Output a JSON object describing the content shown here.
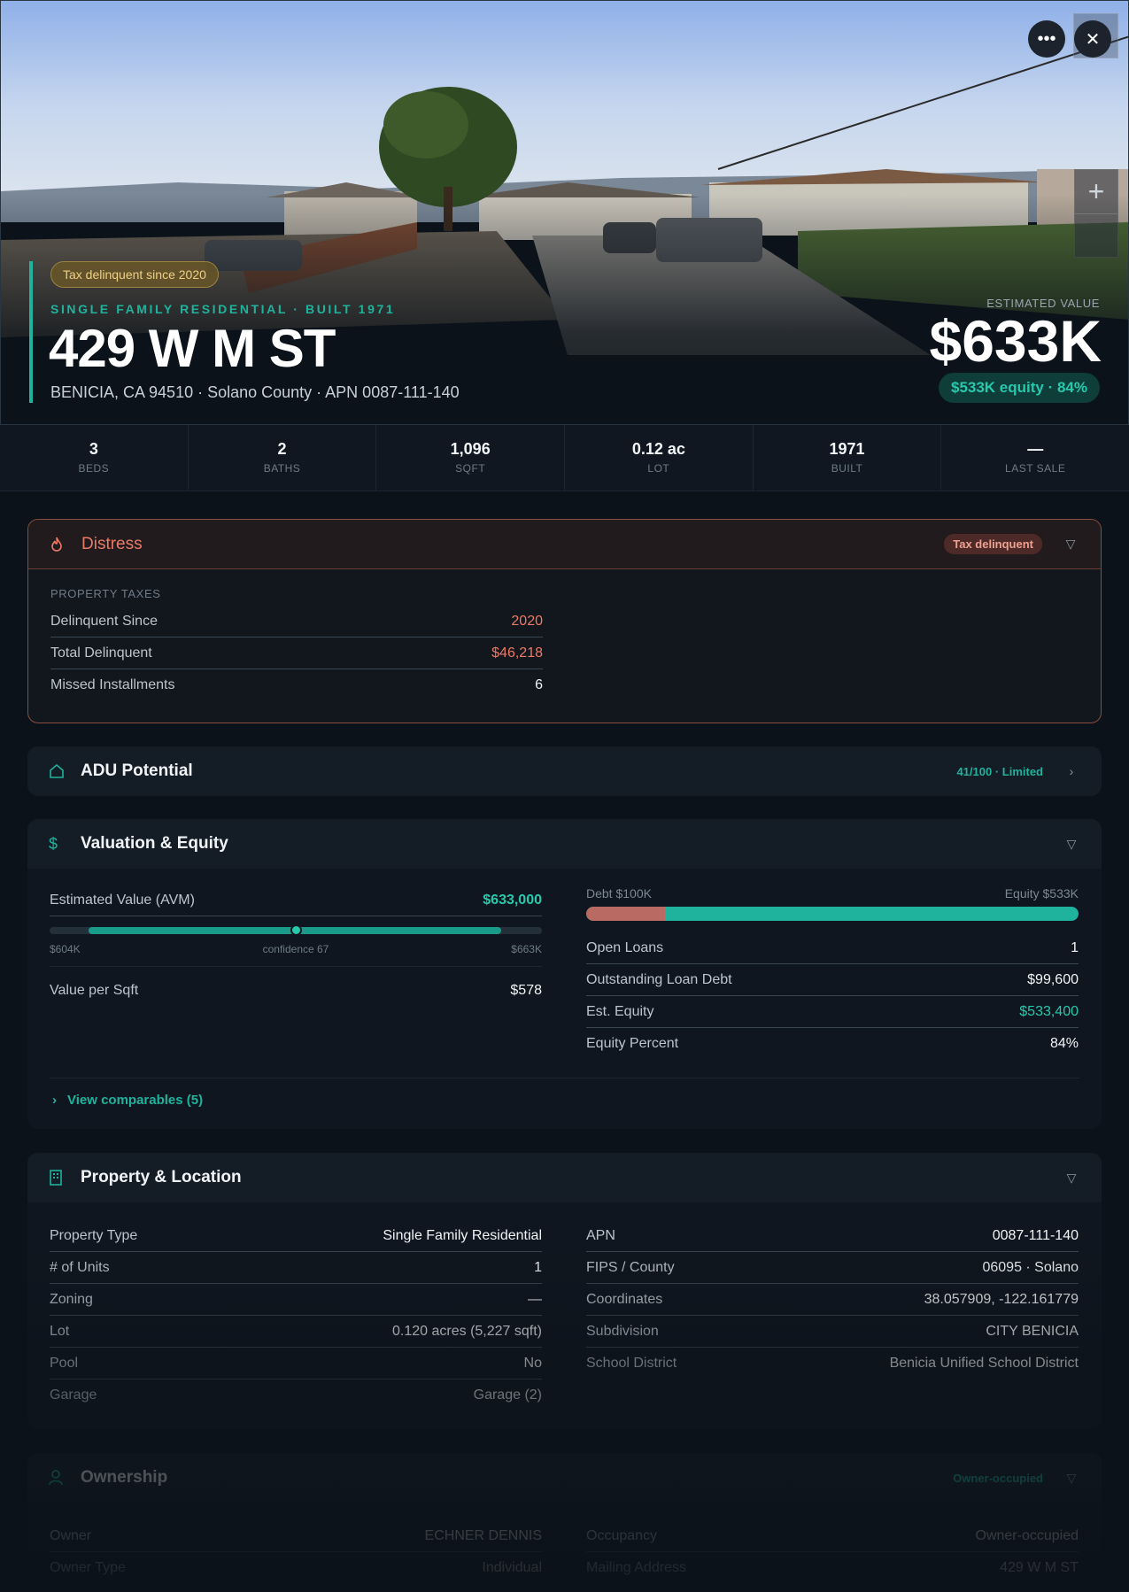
{
  "hero": {
    "tax_badge": "Tax delinquent since 2020",
    "subtitle": "SINGLE FAMILY RESIDENTIAL · BUILT 1971",
    "title": "429 W M ST",
    "address": "BENICIA, CA 94510 · Solano County · APN 0087-111-140",
    "est_label": "ESTIMATED VALUE",
    "est_value": "$633K",
    "equity_pill": "$533K equity · 84%",
    "more_icon": "more-icon",
    "close_icon": "close-icon",
    "zoom_plus": "+"
  },
  "stats": [
    {
      "value": "3",
      "label": "BEDS"
    },
    {
      "value": "2",
      "label": "BATHS"
    },
    {
      "value": "1,096",
      "label": "SQFT"
    },
    {
      "value": "0.12 ac",
      "label": "LOT"
    },
    {
      "value": "1971",
      "label": "BUILT"
    },
    {
      "value": "—",
      "label": "LAST SALE"
    }
  ],
  "distress": {
    "title": "Distress",
    "tag": "Tax delinquent",
    "section": "PROPERTY TAXES",
    "rows": [
      {
        "k": "Delinquent Since",
        "v": "2020"
      },
      {
        "k": "Total Delinquent",
        "v": "$46,218"
      },
      {
        "k": "Missed Installments",
        "v": "6"
      }
    ]
  },
  "adu": {
    "title": "ADU Potential",
    "score": "41/100 · Limited"
  },
  "valuation": {
    "title": "Valuation & Equity",
    "avm_label": "Estimated Value (AVM)",
    "avm_value": "$633,000",
    "avm_low": "$604K",
    "avm_conf": "confidence 67",
    "avm_high": "$663K",
    "avm_position": 0.5,
    "value_per_sqft_label": "Value per Sqft",
    "value_per_sqft": "$578",
    "debt_label": "Debt $100K",
    "equity_label": "Equity $533K",
    "debt_fraction": 0.16,
    "rows": [
      {
        "k": "Open Loans",
        "v": "1"
      },
      {
        "k": "Outstanding Loan Debt",
        "v": "$99,600"
      },
      {
        "k": "Est. Equity",
        "v": "$533,400"
      },
      {
        "k": "Equity Percent",
        "v": "84%"
      }
    ],
    "comparables_link": "View comparables (5)"
  },
  "property": {
    "title": "Property & Location",
    "left": [
      {
        "k": "Property Type",
        "v": "Single Family Residential"
      },
      {
        "k": "# of Units",
        "v": "1"
      },
      {
        "k": "Zoning",
        "v": "—"
      },
      {
        "k": "Lot",
        "v": "0.120 acres (5,227 sqft)"
      },
      {
        "k": "Pool",
        "v": "No"
      },
      {
        "k": "Garage",
        "v": "Garage (2)"
      }
    ],
    "right": [
      {
        "k": "APN",
        "v": "0087-111-140"
      },
      {
        "k": "FIPS / County",
        "v": "06095 · Solano"
      },
      {
        "k": "Coordinates",
        "v": "38.057909, -122.161779"
      },
      {
        "k": "Subdivision",
        "v": "CITY BENICIA"
      },
      {
        "k": "School District",
        "v": "Benicia Unified School District"
      }
    ]
  },
  "ownership": {
    "title": "Ownership",
    "tag": "Owner-occupied",
    "left": [
      {
        "k": "Owner",
        "v": "ECHNER DENNIS"
      },
      {
        "k": "Owner Type",
        "v": "Individual"
      }
    ],
    "right": [
      {
        "k": "Occupancy",
        "v": "Owner-occupied"
      },
      {
        "k": "Mailing Address",
        "v": "429 W M ST"
      }
    ]
  },
  "colors": {
    "accent": "#1fb39d",
    "distress": "#ec7a66",
    "tax_badge": "#f0cf85"
  }
}
